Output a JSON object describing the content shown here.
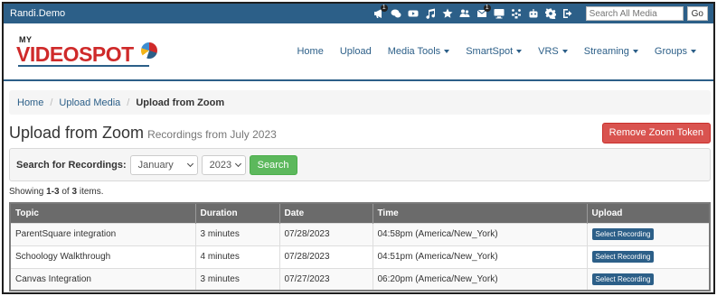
{
  "topbar": {
    "username": "Randi.Demo",
    "icons": [
      {
        "name": "megaphone-icon",
        "badge": "1"
      },
      {
        "name": "chat-icon",
        "badge": ""
      },
      {
        "name": "youtube-icon",
        "badge": ""
      },
      {
        "name": "music-icon",
        "badge": ""
      },
      {
        "name": "star-icon",
        "badge": ""
      },
      {
        "name": "users-icon",
        "badge": ""
      },
      {
        "name": "inbox-icon",
        "badge": "1"
      },
      {
        "name": "monitor-icon",
        "badge": ""
      },
      {
        "name": "group-icon",
        "badge": ""
      },
      {
        "name": "robot-icon",
        "badge": ""
      },
      {
        "name": "gear-icon",
        "badge": ""
      },
      {
        "name": "sign-out-icon",
        "badge": ""
      }
    ],
    "search_placeholder": "Search All Media",
    "go_label": "Go"
  },
  "brand": {
    "my": "MY",
    "name": "VIDEOSPOT"
  },
  "nav": {
    "items": [
      {
        "label": "Home",
        "dropdown": false
      },
      {
        "label": "Upload",
        "dropdown": false
      },
      {
        "label": "Media Tools",
        "dropdown": true
      },
      {
        "label": "SmartSpot",
        "dropdown": true
      },
      {
        "label": "VRS",
        "dropdown": true
      },
      {
        "label": "Streaming",
        "dropdown": true
      },
      {
        "label": "Groups",
        "dropdown": true
      }
    ]
  },
  "breadcrumb": {
    "home": "Home",
    "upload_media": "Upload Media",
    "current": "Upload from Zoom"
  },
  "page": {
    "title": "Upload from Zoom",
    "subtitle": "Recordings from July 2023",
    "remove_button": "Remove Zoom Token"
  },
  "filter": {
    "label": "Search for Recordings:",
    "month": "January",
    "year": "2023",
    "search_button": "Search"
  },
  "summary": {
    "prefix": "Showing ",
    "range": "1-3",
    "mid": " of ",
    "total": "3",
    "suffix": " items."
  },
  "table": {
    "headers": [
      "Topic",
      "Duration",
      "Date",
      "Time",
      "Upload"
    ],
    "rows": [
      {
        "topic": "ParentSquare integration",
        "duration": "3 minutes",
        "date": "07/28/2023",
        "time": "04:58pm (America/New_York)",
        "action": "Select Recording"
      },
      {
        "topic": "Schoology Walkthrough",
        "duration": "4 minutes",
        "date": "07/28/2023",
        "time": "04:51pm (America/New_York)",
        "action": "Select Recording"
      },
      {
        "topic": "Canvas Integration",
        "duration": "3 minutes",
        "date": "07/27/2023",
        "time": "06:20pm (America/New_York)",
        "action": "Select Recording"
      }
    ]
  },
  "colors": {
    "primary": "#2c5f88",
    "danger": "#d9534f",
    "success": "#5cb85c",
    "table_header": "#6b6b6b"
  }
}
